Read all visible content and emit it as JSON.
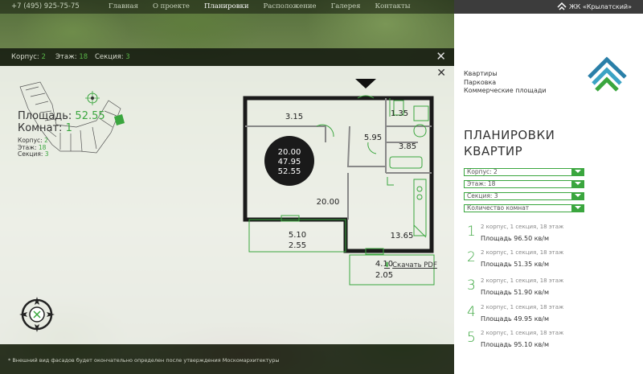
{
  "header": {
    "phone": "+7 (495) 925-75-75",
    "nav": [
      "Главная",
      "О проекте",
      "Планировки",
      "Расположение",
      "Галерея",
      "Контакты"
    ],
    "active": "Планировки",
    "project": "ЖК «Крылатский»"
  },
  "filter_bar": {
    "korpus_label": "Корпус:",
    "korpus": "2",
    "etazh_label": "Этаж:",
    "etazh": "18",
    "sekciya_label": "Секция:",
    "sekciya": "3"
  },
  "apartment": {
    "area_label": "Площадь:",
    "area": "52.55",
    "rooms_label": "Комнат:",
    "rooms": "1",
    "korpus_label": "Корпус:",
    "korpus": "2",
    "etazh_label": "Этаж:",
    "etazh": "18",
    "sekciya_label": "Секция:",
    "sekciya": "3",
    "download": "Скачать PDF"
  },
  "plan": {
    "badge": [
      "20.00",
      "47.95",
      "52.55"
    ],
    "rooms": [
      "3.15",
      "1.35",
      "5.95",
      "3.85",
      "20.00",
      "13.65",
      "5.10",
      "2.55",
      "4.10",
      "2.05"
    ]
  },
  "footer": {
    "note": "* Внешний вид фасадов будет окончательно определен после утверждения Москомархитектуры"
  },
  "sidebar": {
    "menu": [
      "Квартиры",
      "Парковка",
      "Коммерческие площади"
    ],
    "title_line1": "ПЛАНИРОВКИ",
    "title_line2": "КВАРТИР",
    "selects": [
      "Корпус: 2",
      "Этаж: 18",
      "Секция: 3",
      "Количество комнат"
    ],
    "results": [
      {
        "num": "1",
        "desc": "2 корпус, 1 секция, 18 этаж",
        "area": "Площадь 96.50 кв/м"
      },
      {
        "num": "2",
        "desc": "2 корпус, 1 секция, 18 этаж",
        "area": "Площадь 51.35 кв/м"
      },
      {
        "num": "3",
        "desc": "2 корпус, 1 секция, 18 этаж",
        "area": "Площадь 51.90 кв/м"
      },
      {
        "num": "4",
        "desc": "2 корпус, 1 секция, 18 этаж",
        "area": "Площадь 49.95 кв/м"
      },
      {
        "num": "5",
        "desc": "2 корпус, 1 секция, 18 этаж",
        "area": "Площадь 95.10 кв/м"
      }
    ]
  },
  "colors": {
    "accent": "#3aa63e",
    "dark": "#1a1a1a"
  }
}
